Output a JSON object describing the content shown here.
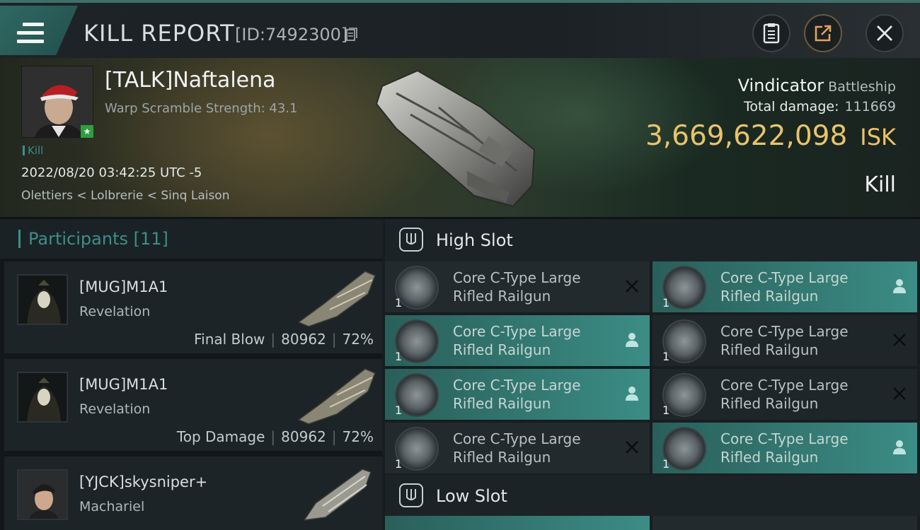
{
  "header": {
    "title": "KILL REPORT",
    "report_id": "[ID:7492300]"
  },
  "victim": {
    "name": "[TALK]Naftalena",
    "scram_label": "Warp Scramble Strength: 43.1",
    "tag": "Kill",
    "datetime": "2022/08/20 03:42:25 UTC -5",
    "location": "Olettiers < Lolbrerie < Sinq Laison",
    "ship_name": "Vindicator",
    "ship_class": "Battleship",
    "total_damage_label": "Total damage:",
    "total_damage": "111669",
    "isk_value": "3,669,622,098",
    "isk_unit": "ISK",
    "kill_type": "Kill"
  },
  "participants": {
    "title": "Participants [11]",
    "items": [
      {
        "name": "[MUG]M1A1",
        "ship": "Revelation",
        "role": "Final Blow",
        "damage": "80962",
        "percent": "72%"
      },
      {
        "name": "[MUG]M1A1",
        "ship": "Revelation",
        "role": "Top Damage",
        "damage": "80962",
        "percent": "72%"
      },
      {
        "name": "[YJCK]skysniper+",
        "ship": "Machariel"
      }
    ]
  },
  "fitting": {
    "high_slot_title": "High Slot",
    "low_slot_title": "Low Slot",
    "modules": [
      {
        "line1": "Core C-Type Large",
        "line2": "Rifled Railgun",
        "qty": "1",
        "state": "destroyed"
      },
      {
        "line1": "Core C-Type Large",
        "line2": "Rifled Railgun",
        "qty": "1",
        "state": "dropped"
      },
      {
        "line1": "Core C-Type Large",
        "line2": "Rifled Railgun",
        "qty": "1",
        "state": "dropped"
      },
      {
        "line1": "Core C-Type Large",
        "line2": "Rifled Railgun",
        "qty": "1",
        "state": "destroyed"
      },
      {
        "line1": "Core C-Type Large",
        "line2": "Rifled Railgun",
        "qty": "1",
        "state": "dropped"
      },
      {
        "line1": "Core C-Type Large",
        "line2": "Rifled Railgun",
        "qty": "1",
        "state": "destroyed"
      },
      {
        "line1": "Core C-Type Large",
        "line2": "Rifled Railgun",
        "qty": "1",
        "state": "destroyed"
      },
      {
        "line1": "Core C-Type Large",
        "line2": "Rifled Railgun",
        "qty": "1",
        "state": "dropped"
      }
    ]
  },
  "colors": {
    "accent_teal": "#3b8f8a",
    "isk_gold": "#e9c36a",
    "dropped_bg": "#3b8d85"
  }
}
